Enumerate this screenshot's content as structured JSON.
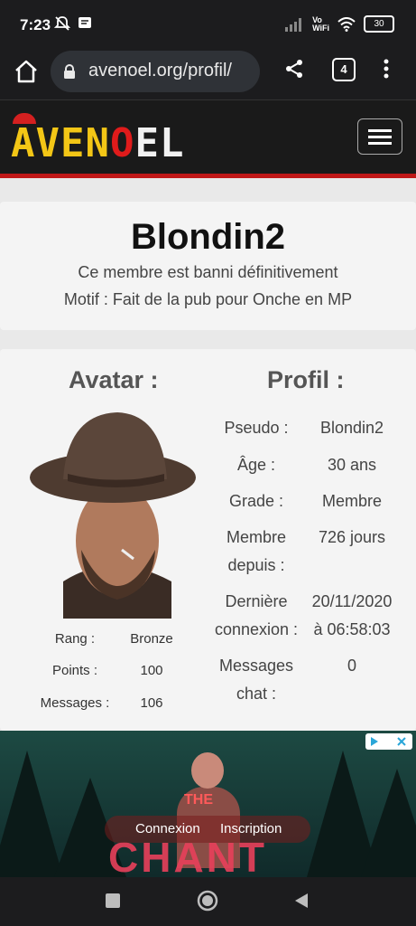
{
  "status": {
    "time": "7:23",
    "vowifi_top": "Vo",
    "vowifi_bottom": "WiFi",
    "battery": "30"
  },
  "browser": {
    "url": "avenoel.org/profil/",
    "tab_count": "4"
  },
  "site": {
    "logo_parts": [
      "AVEN",
      "O",
      "EL"
    ]
  },
  "ban_card": {
    "username": "Blondin2",
    "status": "Ce membre est banni définitivement",
    "reason": "Motif : Fait de la pub pour Onche en MP"
  },
  "avatar_section": {
    "title": "Avatar :",
    "stats": [
      {
        "label": "Rang :",
        "value": "Bronze"
      },
      {
        "label": "Points :",
        "value": "100"
      },
      {
        "label": "Messages :",
        "value": "106"
      }
    ]
  },
  "profile_section": {
    "title": "Profil :",
    "fields": [
      {
        "label1": "Pseudo :",
        "label2": "",
        "value1": "Blondin2",
        "value2": ""
      },
      {
        "label1": "Âge :",
        "label2": "",
        "value1": "30 ans",
        "value2": ""
      },
      {
        "label1": "Grade :",
        "label2": "",
        "value1": "Membre",
        "value2": ""
      },
      {
        "label1": "Membre",
        "label2": "depuis :",
        "value1": "726 jours",
        "value2": ""
      },
      {
        "label1": "Dernière",
        "label2": "connexion :",
        "value1": "20/11/2020",
        "value2": "à 06:58:03"
      },
      {
        "label1": "Messages",
        "label2": "chat :",
        "value1": "0",
        "value2": ""
      }
    ]
  },
  "ad": {
    "title_small": "THE",
    "title_big": "CHANT",
    "connexion": "Connexion",
    "inscription": "Inscription"
  }
}
